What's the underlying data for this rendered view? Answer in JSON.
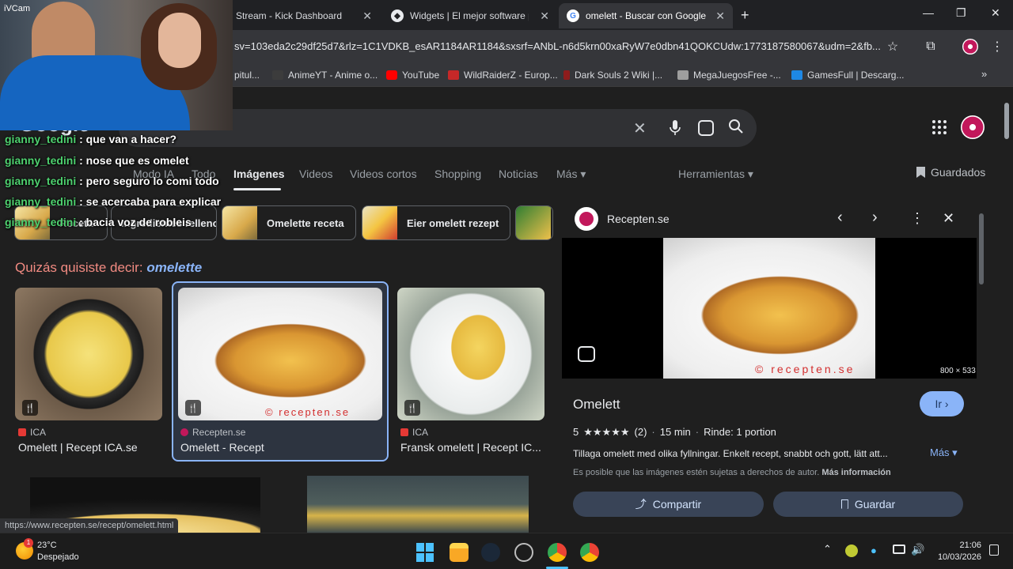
{
  "tabs": [
    {
      "label": "Stream - Kick Dashboard",
      "close": "✕"
    },
    {
      "label": "Widgets | El mejor software pa",
      "close": "✕"
    },
    {
      "label": "omelett - Buscar con Google",
      "close": "✕",
      "active": true
    }
  ],
  "new_tab": "+",
  "window_controls": {
    "minimize": "—",
    "maximize": "❐",
    "close": "✕"
  },
  "url": "sv=103eda2c29df25d7&rlz=1C1VDKB_esAR1184AR1184&sxsrf=ANbL-n6d5krn00xaRyW7e0dbn41QOKCUdw:1773187580067&udm=2&fb...",
  "bookmarks": [
    {
      "label": "pitul..."
    },
    {
      "label": "AnimeYT - Anime o..."
    },
    {
      "label": "YouTube"
    },
    {
      "label": "WildRaiderZ - Europ..."
    },
    {
      "label": "Dark Souls 2 Wiki |..."
    },
    {
      "label": "MegaJuegosFree -..."
    },
    {
      "label": "GamesFull | Descarg..."
    }
  ],
  "search": {
    "logo": "Google",
    "query": "omelett"
  },
  "nav_tabs": [
    "Modo IA",
    "Todo",
    "Imágenes",
    "Videos",
    "Videos cortos",
    "Shopping",
    "Noticias",
    "Más ▾"
  ],
  "tools": "Herramientas ▾",
  "saved": "Guardados",
  "chips": [
    "Receta",
    "Ingredientes relleno",
    "Omelette receta",
    "Eier omelett rezept"
  ],
  "did_you_mean": {
    "prefix": "Quizás quisiste decir:",
    "suggestion": "omelette"
  },
  "results": [
    {
      "source": "ICA",
      "title": "Omelett | Recept ICA.se"
    },
    {
      "source": "Recepten.se",
      "title": "Omelett - Recept",
      "watermark": "© recepten.se"
    },
    {
      "source": "ICA",
      "title": "Fransk omelett | Recept IC..."
    }
  ],
  "panel": {
    "site": "Recepten.se",
    "dimensions": "800 × 533",
    "watermark": "© recepten.se",
    "title": "Omelett",
    "go": "Ir ›",
    "meta": {
      "rating": "5",
      "stars": "★★★★★",
      "reviews": "(2)",
      "time": "15 min",
      "yield": "Rinde: 1 portion"
    },
    "description": "Tillaga omelett med olika fyllningar. Enkelt recept, snabbt och gott, lätt att...",
    "more": "Más ▾",
    "copyright": "Es posible que las imágenes estén sujetas a derechos de autor.",
    "copyright_link": "Más información",
    "share": "Compartir",
    "save": "Guardar"
  },
  "webcam_label": "iVCam",
  "chat": [
    {
      "user": "gianny_tedini",
      "msg": ": que van a hacer?"
    },
    {
      "user": "gianny_tedini",
      "msg": ": nose que es omelet"
    },
    {
      "user": "gianny_tedini",
      "msg": ": pero seguro lo comi todo"
    },
    {
      "user": "gianny_tedini",
      "msg": ": se acercaba para explicar"
    },
    {
      "user": "gianny_tedini",
      "msg": ": bacia voz de robleis"
    }
  ],
  "status_url": "https://www.recepten.se/recept/omelett.html",
  "taskbar": {
    "weather_temp": "23°C",
    "weather_desc": "Despejado",
    "weather_badge": "1",
    "time": "21:06",
    "date": "10/03/2026"
  }
}
